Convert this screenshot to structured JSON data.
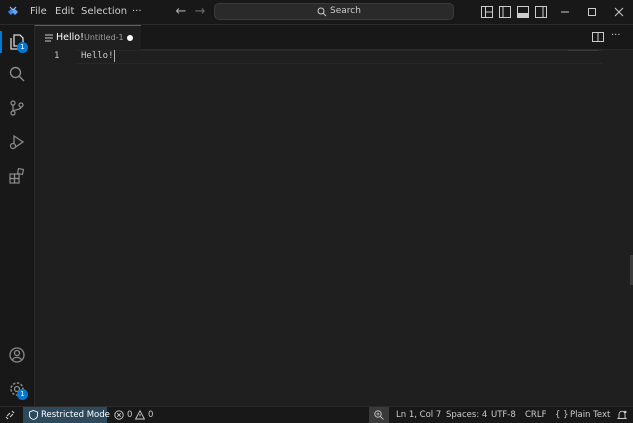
{
  "menu": [
    "File",
    "Edit",
    "Selection",
    "···"
  ],
  "search": {
    "label": "Search"
  },
  "activity": {
    "explorer_badge": "1",
    "settings_badge": "1"
  },
  "tab": {
    "name": "Hello!",
    "description": "Untitled-1",
    "more": "···"
  },
  "editor": {
    "line_number": "1",
    "line_text": "Hello!"
  },
  "status": {
    "restricted_mode": "Restricted Mode",
    "errors": "0",
    "warnings": "0",
    "cursor": "Ln 1, Col 7",
    "spaces": "Spaces: 4",
    "encoding": "UTF-8",
    "eol": "CRLF",
    "language_brace": "{ }",
    "language": "Plain Text"
  },
  "colors": {
    "accent": "#0078d4",
    "background": "#1f1f1f",
    "chrome": "#181818",
    "restricted": "#2d4a5c"
  }
}
